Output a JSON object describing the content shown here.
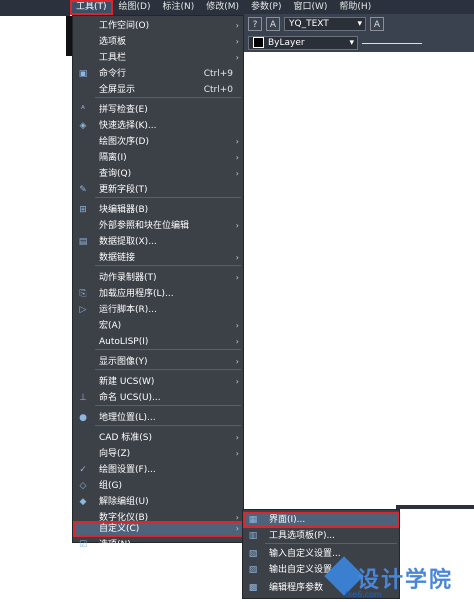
{
  "menubar": [
    "工具(T)",
    "绘图(D)",
    "标注(N)",
    "修改(M)",
    "参数(P)",
    "窗口(W)",
    "帮助(H)"
  ],
  "toolbar": {
    "text_style": "YQ_TEXT",
    "layer": "ByLayer",
    "help_icon": "?"
  },
  "menu_items": [
    {
      "label": "工作空间(O)",
      "arrow": true
    },
    {
      "label": "选项板",
      "arrow": true
    },
    {
      "label": "工具栏",
      "arrow": true
    },
    {
      "label": "命令行",
      "shortcut": "Ctrl+9",
      "icon": "▣"
    },
    {
      "label": "全屏显示",
      "shortcut": "Ctrl+0"
    },
    {
      "label": "拼写检查(E)",
      "icon": "ᴬ"
    },
    {
      "label": "快速选择(K)...",
      "icon": "◈"
    },
    {
      "label": "绘图次序(D)",
      "arrow": true
    },
    {
      "label": "隔离(I)",
      "arrow": true
    },
    {
      "label": "查询(Q)",
      "arrow": true
    },
    {
      "label": "更新字段(T)",
      "icon": "✎"
    },
    {
      "label": "块编辑器(B)",
      "icon": "⊞"
    },
    {
      "label": "外部参照和块在位编辑",
      "arrow": true
    },
    {
      "label": "数据提取(X)...",
      "icon": "▤"
    },
    {
      "label": "数据链接",
      "arrow": true
    },
    {
      "label": "动作录制器(T)",
      "arrow": true
    },
    {
      "label": "加载应用程序(L)...",
      "icon": "⎘"
    },
    {
      "label": "运行脚本(R)...",
      "icon": "▷"
    },
    {
      "label": "宏(A)",
      "arrow": true
    },
    {
      "label": "AutoLISP(I)",
      "arrow": true
    },
    {
      "label": "显示图像(Y)",
      "arrow": true
    },
    {
      "label": "新建 UCS(W)",
      "arrow": true
    },
    {
      "label": "命名 UCS(U)...",
      "icon": "⊥"
    },
    {
      "label": "地理位置(L)...",
      "icon": "●"
    },
    {
      "label": "CAD 标准(S)",
      "arrow": true
    },
    {
      "label": "向导(Z)",
      "arrow": true
    },
    {
      "label": "绘图设置(F)...",
      "icon": "✓"
    },
    {
      "label": "组(G)",
      "icon": "◇"
    },
    {
      "label": "解除编组(U)",
      "icon": "◆"
    },
    {
      "label": "数字化仪(B)",
      "arrow": true
    },
    {
      "label": "自定义(C)",
      "arrow": true
    },
    {
      "label": "选项(N)...",
      "icon": "☑"
    }
  ],
  "submenu_items": [
    {
      "label": "界面(I)...",
      "icon": "▦"
    },
    {
      "label": "工具选项板(P)...",
      "icon": "▥"
    },
    {
      "label": "输入自定义设置...",
      "icon": "▧"
    },
    {
      "label": "输出自定义设置...",
      "icon": "▨"
    },
    {
      "label": "编辑程序参数",
      "icon": "▩"
    }
  ],
  "watermark": {
    "title": "设计学院",
    "url": "fke6.com"
  }
}
